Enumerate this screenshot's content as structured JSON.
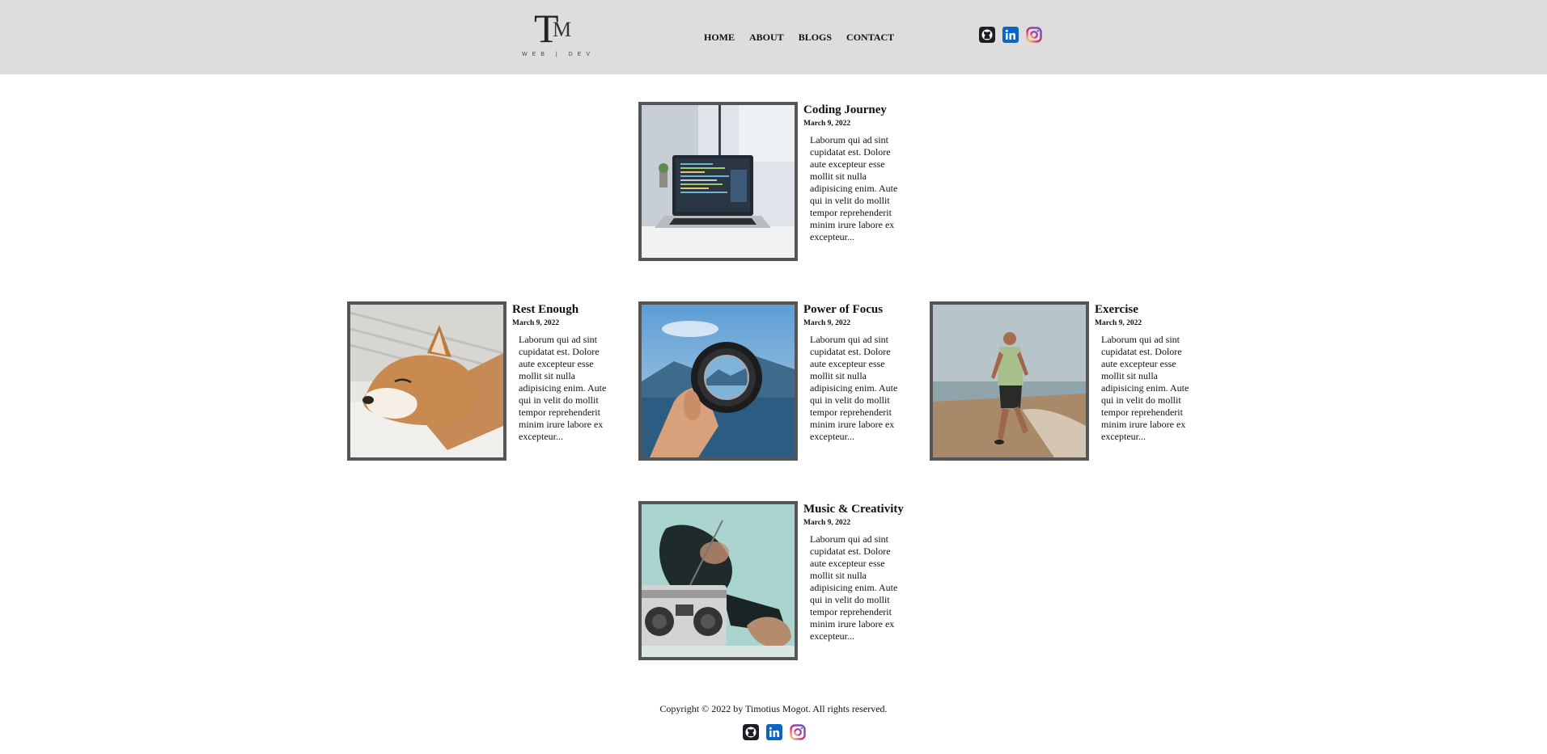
{
  "logo": {
    "mark_t": "T",
    "mark_m": "M",
    "subtitle": "WEB | DEV"
  },
  "nav": {
    "home": "HOME",
    "about": "ABOUT",
    "blogs": "BLOGS",
    "contact": "CONTACT"
  },
  "social": {
    "icons": [
      "github-icon",
      "linkedin-icon",
      "instagram-icon"
    ]
  },
  "posts": [
    {
      "title": "Coding Journey",
      "date": "March 9, 2022",
      "excerpt": "Laborum qui ad sint cupidatat est. Dolore aute excepteur esse mollit sit nulla adipisicing enim. Aute qui in velit do mollit tempor reprehenderit minim irure labore ex excepteur..."
    },
    {
      "title": "Rest Enough",
      "date": "March 9, 2022",
      "excerpt": "Laborum qui ad sint cupidatat est. Dolore aute excepteur esse mollit sit nulla adipisicing enim. Aute qui in velit do mollit tempor reprehenderit minim irure labore ex excepteur..."
    },
    {
      "title": "Power of Focus",
      "date": "March 9, 2022",
      "excerpt": "Laborum qui ad sint cupidatat est. Dolore aute excepteur esse mollit sit nulla adipisicing enim. Aute qui in velit do mollit tempor reprehenderit minim irure labore ex excepteur..."
    },
    {
      "title": "Exercise",
      "date": "March 9, 2022",
      "excerpt": "Laborum qui ad sint cupidatat est. Dolore aute excepteur esse mollit sit nulla adipisicing enim. Aute qui in velit do mollit tempor reprehenderit minim irure labore ex excepteur..."
    },
    {
      "title": "Music & Creativity",
      "date": "March 9, 2022",
      "excerpt": "Laborum qui ad sint cupidatat est. Dolore aute excepteur esse mollit sit nulla adipisicing enim. Aute qui in velit do mollit tempor reprehenderit minim irure labore ex excepteur..."
    }
  ],
  "footer": {
    "copyright": "Copyright © 2022 by Timotius Mogot. All rights reserved."
  },
  "colors": {
    "header_bg": "#dedcdd",
    "frame": "#555555",
    "linkedin": "#0a66c2",
    "github": "#1b1f23"
  }
}
